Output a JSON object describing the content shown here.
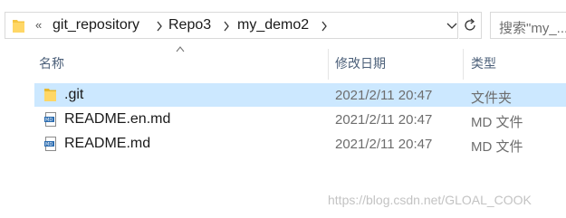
{
  "address_bar": {
    "overflow_indicator": "«",
    "crumbs": [
      "git_repository",
      "Repo3",
      "my_demo2"
    ]
  },
  "search": {
    "placeholder": "搜索\"my_..."
  },
  "columns": {
    "name": "名称",
    "modified": "修改日期",
    "type": "类型"
  },
  "files": [
    {
      "name": ".git",
      "modified": "2021/2/11 20:47",
      "type": "文件夹",
      "icon": "folder-icon",
      "selected": true
    },
    {
      "name": "README.en.md",
      "modified": "2021/2/11 20:47",
      "type": "MD 文件",
      "icon": "md-file-icon",
      "selected": false
    },
    {
      "name": "README.md",
      "modified": "2021/2/11 20:47",
      "type": "MD 文件",
      "icon": "md-file-icon",
      "selected": false
    }
  ],
  "watermark": "https://blog.csdn.net/GLOAL_COOK",
  "colors": {
    "selection": "#cce8ff",
    "folder": "#f5c542",
    "header_text": "#4c607a"
  }
}
